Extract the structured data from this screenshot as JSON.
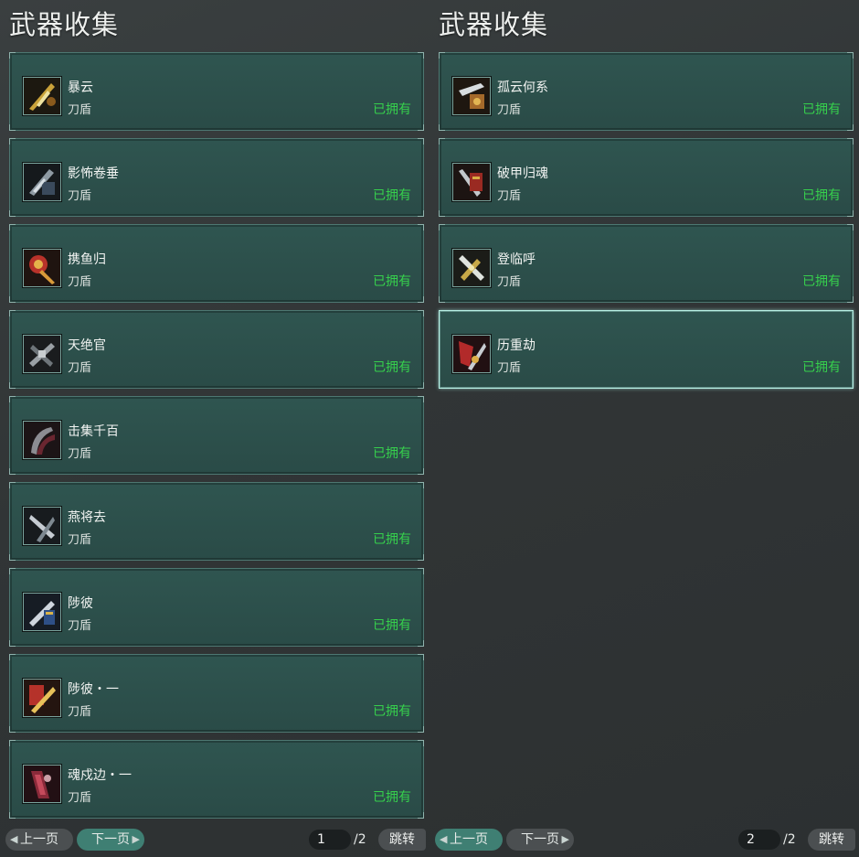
{
  "left_panel": {
    "title": "武器收集",
    "items": [
      {
        "name": "暴云",
        "type": "刀盾",
        "status": "已拥有",
        "icon": "golden-blade-icon"
      },
      {
        "name": "影怖卷垂",
        "type": "刀盾",
        "status": "已拥有",
        "icon": "dark-armor-blade-icon"
      },
      {
        "name": "携鱼归",
        "type": "刀盾",
        "status": "已拥有",
        "icon": "red-gold-fish-blade-icon"
      },
      {
        "name": "天绝官",
        "type": "刀盾",
        "status": "已拥有",
        "icon": "grey-crossed-blades-icon"
      },
      {
        "name": "击集千百",
        "type": "刀盾",
        "status": "已拥有",
        "icon": "dark-red-claw-blade-icon"
      },
      {
        "name": "燕将去",
        "type": "刀盾",
        "status": "已拥有",
        "icon": "silver-blade-icon"
      },
      {
        "name": "陟彼",
        "type": "刀盾",
        "status": "已拥有",
        "icon": "blue-gold-sword-icon"
      },
      {
        "name": "陟彼・一",
        "type": "刀盾",
        "status": "已拥有",
        "icon": "red-gold-sword-icon"
      },
      {
        "name": "魂戍边・一",
        "type": "刀盾",
        "status": "已拥有",
        "icon": "crimson-blade-icon"
      }
    ],
    "pager": {
      "prev": "上一页",
      "next": "下一页",
      "page": "1",
      "total": "/2",
      "jump": "跳转"
    }
  },
  "right_panel": {
    "title": "武器收集",
    "items": [
      {
        "name": "孤云何系",
        "type": "刀盾",
        "status": "已拥有",
        "icon": "bronze-blade-icon"
      },
      {
        "name": "破甲归魂",
        "type": "刀盾",
        "status": "已拥有",
        "icon": "red-armor-blade-icon"
      },
      {
        "name": "登临呼",
        "type": "刀盾",
        "status": "已拥有",
        "icon": "gold-silver-blade-icon"
      },
      {
        "name": "历重劫",
        "type": "刀盾",
        "status": "已拥有",
        "icon": "red-gold-claw-icon"
      }
    ],
    "pager": {
      "prev": "上一页",
      "next": "下一页",
      "page": "2",
      "total": "/2",
      "jump": "跳转"
    }
  },
  "colors": {
    "card_bg": "#2f5550",
    "owned_status": "#36d04c",
    "active_button": "#3f7f73",
    "inactive_button": "#4b4f51",
    "selected_border": "#b7efe4"
  }
}
